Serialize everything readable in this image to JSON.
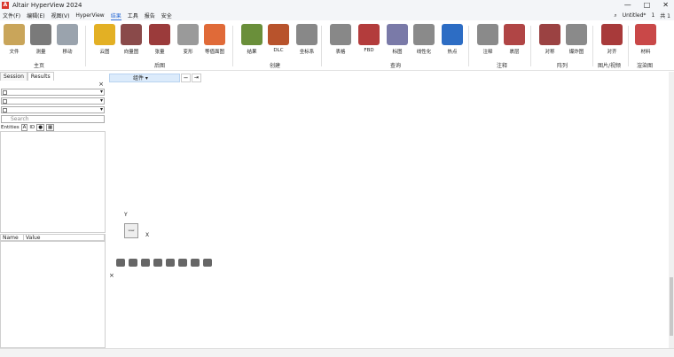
{
  "window": {
    "title": "Altair HyperView 2024",
    "min": "—",
    "max": "□",
    "close": "✕"
  },
  "menu": {
    "items": [
      "文件(F)",
      "编辑(E)",
      "视图(V)",
      "HyperView",
      "结果",
      "工具",
      "报告",
      "安全"
    ],
    "active": "结果",
    "right": {
      "search": "⌕",
      "session": "Untitled*",
      "page": "1",
      "pages": "共 1"
    }
  },
  "ribbon": {
    "buttons": [
      {
        "label": "文件",
        "color": "#c9a55a"
      },
      {
        "label": "测量",
        "color": "#7a7a7a"
      },
      {
        "label": "移动",
        "color": "#9aa3ad"
      },
      {
        "label": "云图",
        "color": "#e3b024"
      },
      {
        "label": "向量图",
        "color": "#8a4a4a"
      },
      {
        "label": "张量",
        "color": "#9b3b3b"
      },
      {
        "label": "变形",
        "color": "#9a9a9a"
      },
      {
        "label": "等值面图",
        "color": "#e06a38"
      },
      {
        "label": "结果",
        "color": "#6a8f3a"
      },
      {
        "label": "DLC",
        "color": "#b8532c"
      },
      {
        "label": "坐标系",
        "color": "#888888"
      },
      {
        "label": "表格",
        "color": "#888888"
      },
      {
        "label": "FBD",
        "color": "#b33c3c"
      },
      {
        "label": "标图",
        "color": "#7a7aa8"
      },
      {
        "label": "线性化",
        "color": "#8a8a8a"
      },
      {
        "label": "热点",
        "color": "#2d6dc4"
      },
      {
        "label": "注释",
        "color": "#8a8a8a"
      },
      {
        "label": "裹层",
        "color": "#b04545"
      },
      {
        "label": "对称",
        "color": "#9b4242"
      },
      {
        "label": "爆炸图",
        "color": "#8a8a8a"
      },
      {
        "label": "对齐",
        "color": "#a83a3a"
      },
      {
        "label": "材料",
        "color": "#c94848"
      }
    ],
    "groups": [
      "主页",
      "后图",
      "创建",
      "查询",
      "注释",
      "阵列",
      "图片/视频",
      "渲染图"
    ]
  },
  "left_panel": {
    "tabs": [
      "Session",
      "Results"
    ],
    "search_placeholder": "Search",
    "entities_label": "Entities",
    "id_label": "ID",
    "prop_headers": [
      "Name",
      "Value"
    ]
  },
  "viewport": {
    "toolbar_label": "组件 ▾",
    "axis_y": "Y",
    "axis_x": "X"
  }
}
